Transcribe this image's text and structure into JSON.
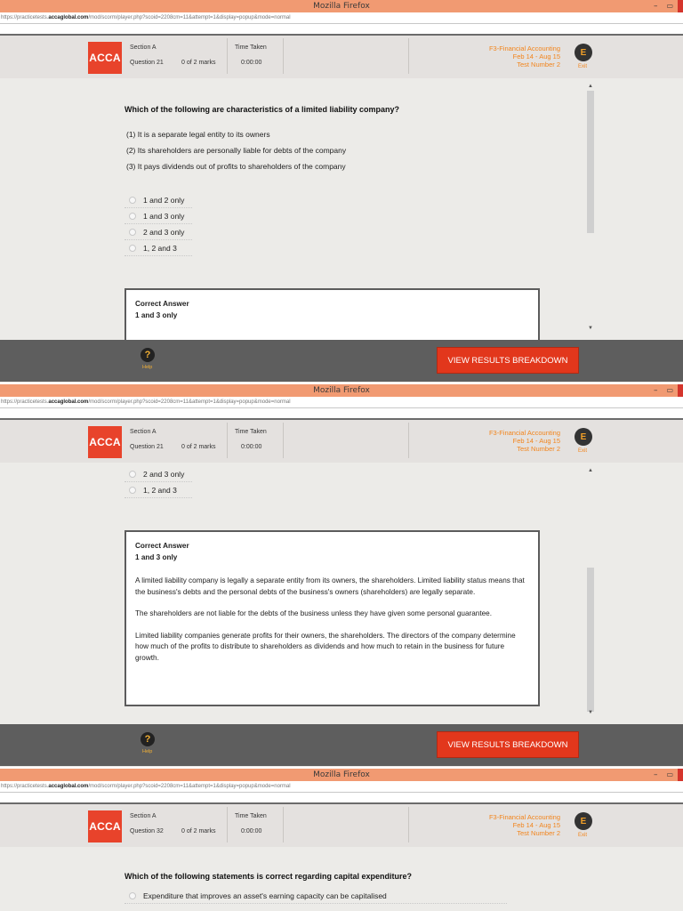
{
  "window": {
    "title": "Mozilla Firefox",
    "url_prefix": "https://practicetests.",
    "url_host": "accaglobal.com",
    "url_rest": "/mod/scorm/player.php?scoid=2208cm=11&attempt=1&display=popup&mode=normal",
    "min_label": "–",
    "max_label": "▭"
  },
  "header": {
    "logo": "ACCA",
    "section_label": "Section A",
    "time_label": "Time Taken",
    "time_value": "0:00:00",
    "marks": "0 of 2 marks",
    "course_line1": "F3-Financial Accounting",
    "course_line2": "Feb 14 - Aug 15",
    "course_line3": "Test Number 2",
    "exit_icon": "E",
    "exit_label": "Exit"
  },
  "panel1": {
    "question_number": "Question 21",
    "question": "Which of the following are characteristics of a limited liability company?",
    "statements": [
      "(1)   It is a separate legal entity to its owners",
      "(2)   Its shareholders are personally liable for debts of the company",
      "(3)   It pays dividends out of profits to shareholders of the company"
    ],
    "options": [
      "1 and 2 only",
      "1 and 3 only",
      "2 and 3 only",
      "1, 2 and 3"
    ],
    "correct_heading": "Correct Answer",
    "correct_value": "1 and 3 only"
  },
  "panel2": {
    "question_number": "Question 21",
    "options": [
      "2 and 3 only",
      "1, 2 and 3"
    ],
    "correct_heading": "Correct Answer",
    "correct_value": "1 and 3 only",
    "explanation": [
      "A limited liability company is legally a separate entity from its owners, the shareholders. Limited liability status means that the business's debts and the personal debts of the business's owners (shareholders) are legally separate.",
      "The shareholders are not liable for the debts of the business unless they have given some personal guarantee.",
      "Limited liability companies generate profits for their owners, the shareholders. The directors of the company determine how much of the profits to distribute to shareholders as dividends and how much to retain in the business for future growth."
    ]
  },
  "panel3": {
    "question_number": "Question 32",
    "question": "Which of the following statements is correct regarding capital expenditure?",
    "options": [
      "Expenditure that improves an asset's earning capacity can be capitalised"
    ]
  },
  "footer": {
    "help_icon": "?",
    "help_label": "Help",
    "results_button": "VIEW RESULTS BREAKDOWN"
  },
  "colors": {
    "titlebar": "#f19a72",
    "brand": "#e8432b",
    "accent_orange": "#f2841b",
    "button_red": "#e2371c",
    "footer_bg": "#5e5e5e"
  }
}
